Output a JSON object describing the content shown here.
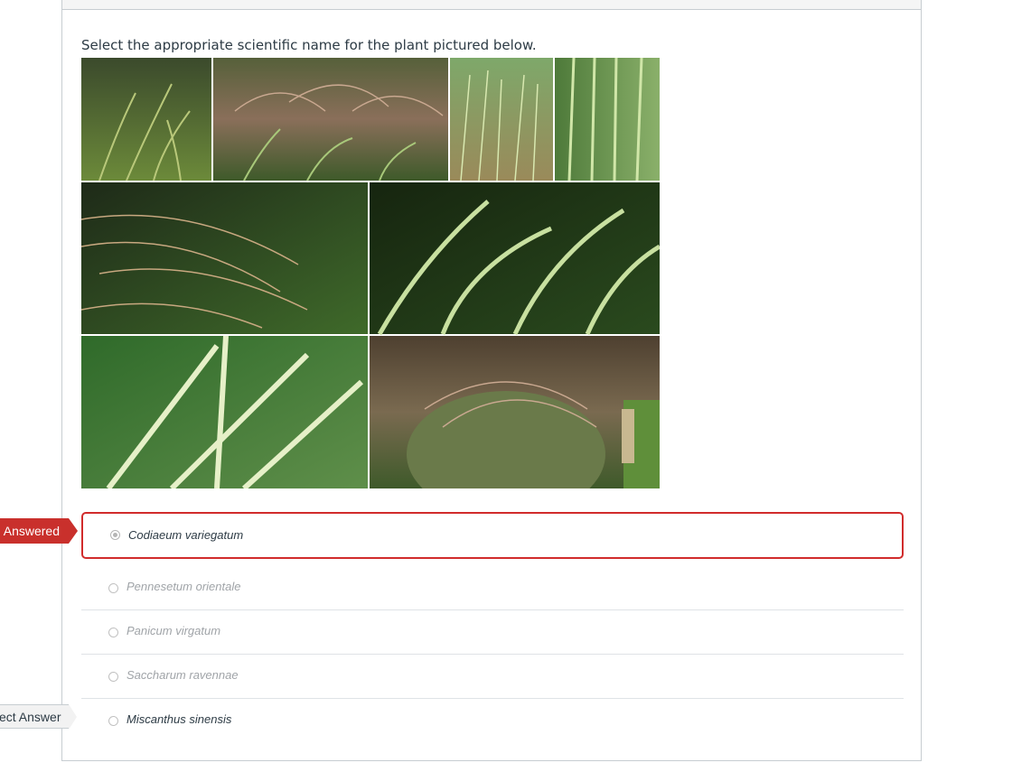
{
  "question": {
    "prompt": "Select the appropriate scientific name for the plant pictured below.",
    "image_description_icon": "plant-photo-collage"
  },
  "answers": [
    {
      "label": "Codiaeum  variegatum",
      "selected": true
    },
    {
      "label": "Pennesetum orientale",
      "selected": false
    },
    {
      "label": "Panicum virgatum",
      "selected": false
    },
    {
      "label": "Saccharum ravennae",
      "selected": false
    },
    {
      "label": "Miscanthus sinensis",
      "selected": false
    }
  ],
  "flags": {
    "answered": "Answered",
    "correct": "ect Answer"
  },
  "colors": {
    "incorrect_red": "#c9302c",
    "text": "#2d3b45",
    "muted": "#a0a4a8"
  }
}
